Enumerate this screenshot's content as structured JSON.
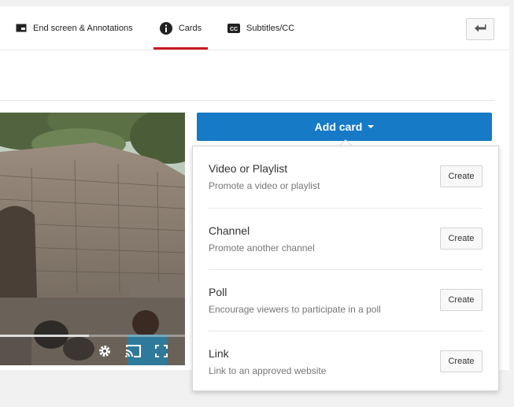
{
  "tabs": [
    {
      "label": "End screen & Annotations",
      "icon": "end-screen-icon"
    },
    {
      "label": "Cards",
      "icon": "info-icon",
      "active": true
    },
    {
      "label": "Subtitles/CC",
      "icon": "cc-icon"
    }
  ],
  "back_button": {
    "icon": "back-arrow-icon"
  },
  "video": {
    "progress": 0.48
  },
  "add_card": {
    "label": "Add card"
  },
  "menu": {
    "create_label": "Create",
    "items": [
      {
        "title": "Video or Playlist",
        "subtitle": "Promote a video or playlist"
      },
      {
        "title": "Channel",
        "subtitle": "Promote another channel"
      },
      {
        "title": "Poll",
        "subtitle": "Encourage viewers to participate in a poll"
      },
      {
        "title": "Link",
        "subtitle": "Link to an approved website"
      }
    ]
  },
  "colors": {
    "accent_blue": "#167ac6",
    "active_tab_underline": "#cc181e",
    "background": "#f1f1f1"
  }
}
